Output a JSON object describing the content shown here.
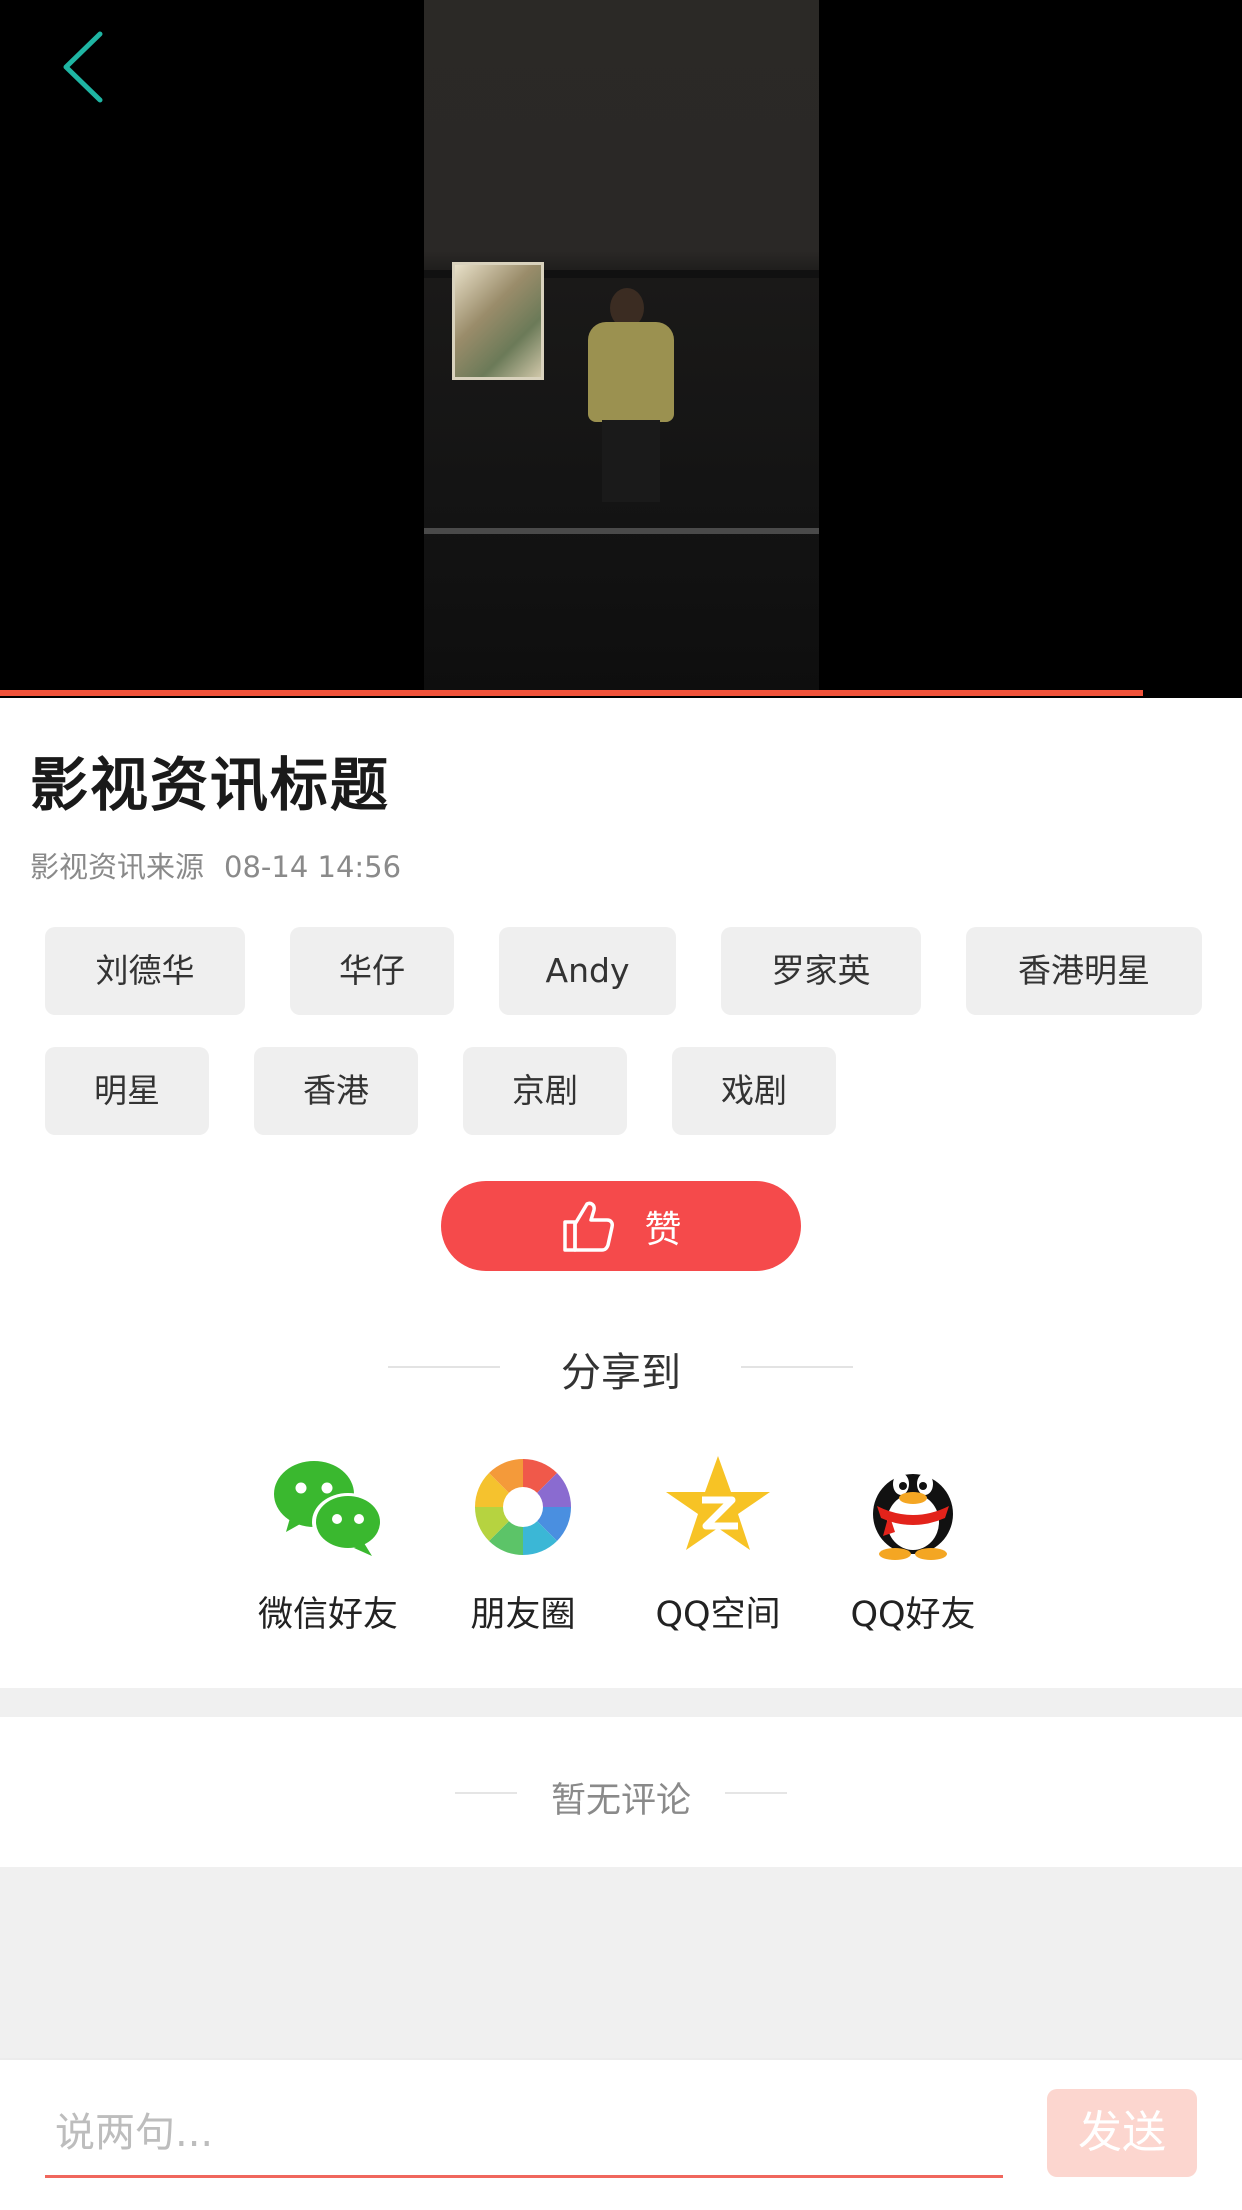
{
  "video": {
    "progress_fraction": 0.92
  },
  "article": {
    "title": "影视资讯标题",
    "source": "影视资讯来源",
    "timestamp": "08-14 14:56"
  },
  "tags": [
    "刘德华",
    "华仔",
    "Andy",
    "罗家英",
    "香港明星",
    "明星",
    "香港",
    "京剧",
    "戏剧"
  ],
  "like": {
    "label": "赞"
  },
  "share": {
    "title": "分享到",
    "items": [
      {
        "label": "微信好友",
        "icon": "wechat-icon"
      },
      {
        "label": "朋友圈",
        "icon": "moments-icon"
      },
      {
        "label": "QQ空间",
        "icon": "qzone-icon"
      },
      {
        "label": "QQ好友",
        "icon": "qq-icon"
      }
    ]
  },
  "comments": {
    "empty_text": "暂无评论"
  },
  "input": {
    "placeholder": "说两句...",
    "value": ""
  },
  "send": {
    "label": "发送"
  },
  "colors": {
    "accent_red": "#f54a4b",
    "progress": "#f0523a",
    "back_arrow": "#1fb5a3",
    "send_disabled": "#fcd6cf"
  }
}
